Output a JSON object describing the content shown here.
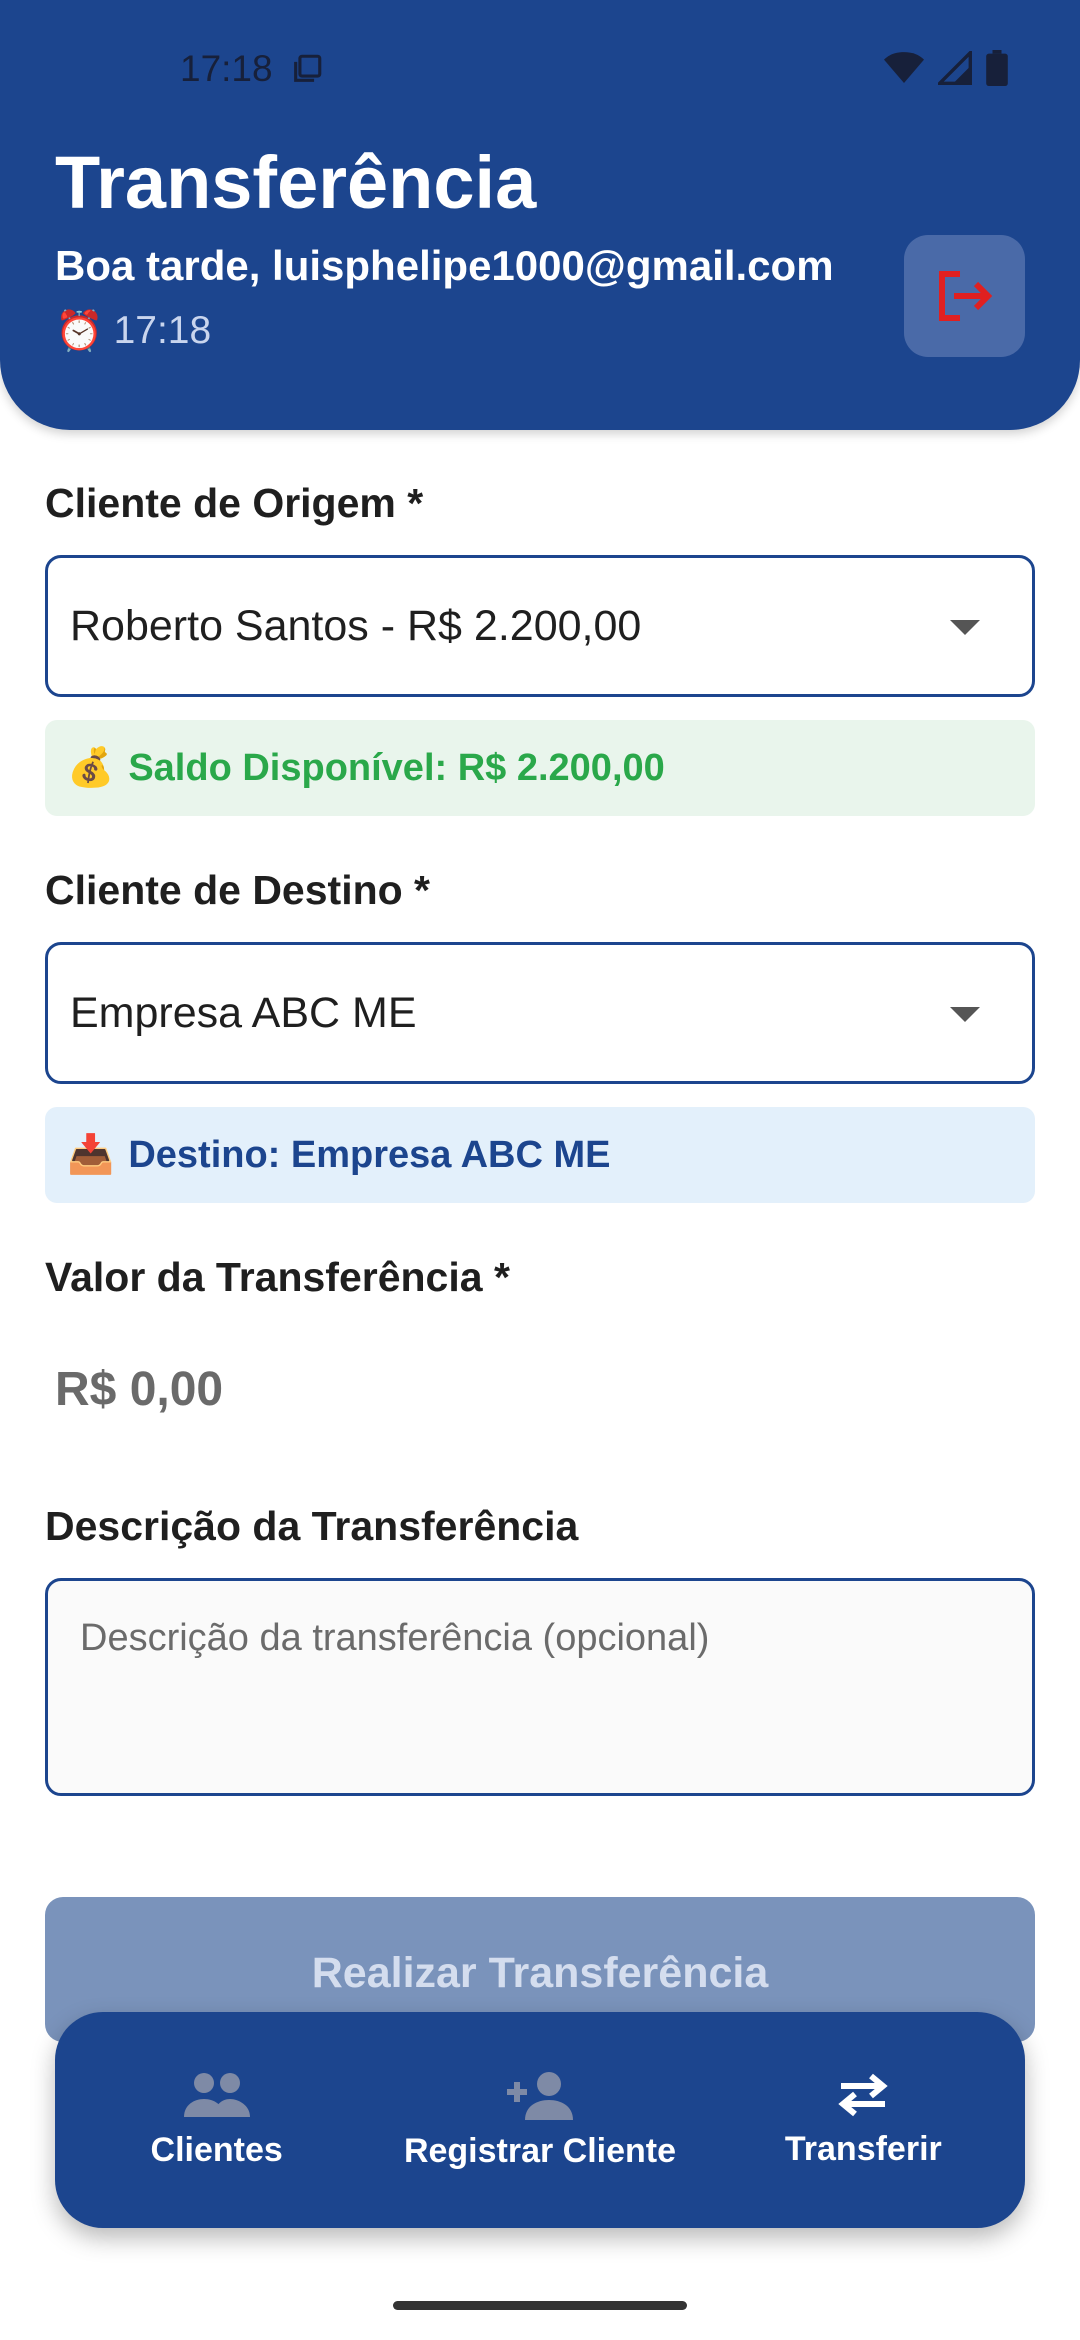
{
  "status_bar": {
    "time": "17:18",
    "icons": [
      "copy-icon",
      "wifi-icon",
      "signal-icon",
      "battery-icon"
    ]
  },
  "header": {
    "title": "Transferência",
    "greeting": "Boa tarde, luisphelipe1000@gmail.com",
    "clock_emoji": "⏰",
    "clock_time": "17:18",
    "logout_icon": "logout-icon"
  },
  "form": {
    "origin_label": "Cliente de Origem *",
    "origin_value": "Roberto Santos - R$ 2.200,00",
    "balance_emoji": "💰",
    "balance_text": "Saldo Disponível: R$ 2.200,00",
    "destination_label": "Cliente de Destino *",
    "destination_value": "Empresa ABC ME",
    "destination_emoji": "📥",
    "destination_text": "Destino: Empresa ABC ME",
    "amount_label": "Valor da Transferência *",
    "amount_value": "R$ 0,00",
    "description_label": "Descrição da Transferência",
    "description_placeholder": "Descrição da transferência (opcional)",
    "submit_label": "Realizar Transferência"
  },
  "bottom_nav": {
    "items": [
      {
        "label": "Clientes",
        "icon": "people-icon",
        "active": false
      },
      {
        "label": "Registrar Cliente",
        "icon": "person-add-icon",
        "active": false
      },
      {
        "label": "Transferir",
        "icon": "swap-icon",
        "active": true
      }
    ]
  },
  "colors": {
    "primary": "#1c458e",
    "logout_red": "#e02020",
    "success_green": "#2aa84a",
    "disabled_button": "#7a93bb"
  }
}
